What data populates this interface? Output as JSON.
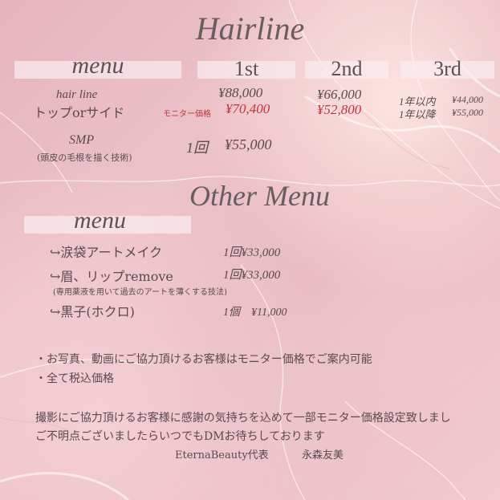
{
  "header": {
    "title": "Hairline"
  },
  "tiers": {
    "col1": "1st",
    "col2": "2nd",
    "col3": "3rd"
  },
  "hairline_section": {
    "menu_label": "menu",
    "item_name_en": "hair line",
    "item_name_jp": "トップorサイド",
    "price_1st": "¥88,000",
    "monitor_label": "モニター価格",
    "monitor_price_1st": "¥70,400",
    "price_2nd": "¥66,000",
    "monitor_price_2nd": "¥52,800",
    "third_within_label": "1年以内",
    "third_within_price": "¥44,000",
    "third_after_label": "1年以降",
    "third_after_price": "¥55,000",
    "smp_name": "SMP",
    "smp_desc": "(頭皮の毛根を描く技術)",
    "smp_count": "1回",
    "smp_price": "¥55,000"
  },
  "other_section": {
    "title": "Other Menu",
    "menu_label": "menu",
    "items": [
      {
        "arrow": "↪",
        "name": "涙袋アートメイク",
        "price": "1回¥33,000"
      },
      {
        "arrow": "↪",
        "name": "眉、リップremove",
        "price": "1回¥33,000",
        "note": "(専用薬液を用いて過去のアートを薄くする技法)"
      },
      {
        "arrow": "↪",
        "name": "黒子(ホクロ)",
        "price": "1個　¥11,000"
      }
    ]
  },
  "notes": [
    "・お写真、動画にご協力頂けるお客様はモニター価格でご案内可能",
    "・全て税込価格"
  ],
  "footer": {
    "line1": "撮影にご協力頂けるお客様に感謝の気持ちを込めて一部モニター価格設定致しまし",
    "line2": "ご不明点ございましたらいつでもDMお待ちしております",
    "brand": "EternaBeauty代表",
    "owner": "永森友美"
  },
  "colors": {
    "background": "#e8b8c1",
    "text": "#5a4a4e",
    "accent_red": "#c1353f",
    "label_box": "#f7e6ea"
  }
}
